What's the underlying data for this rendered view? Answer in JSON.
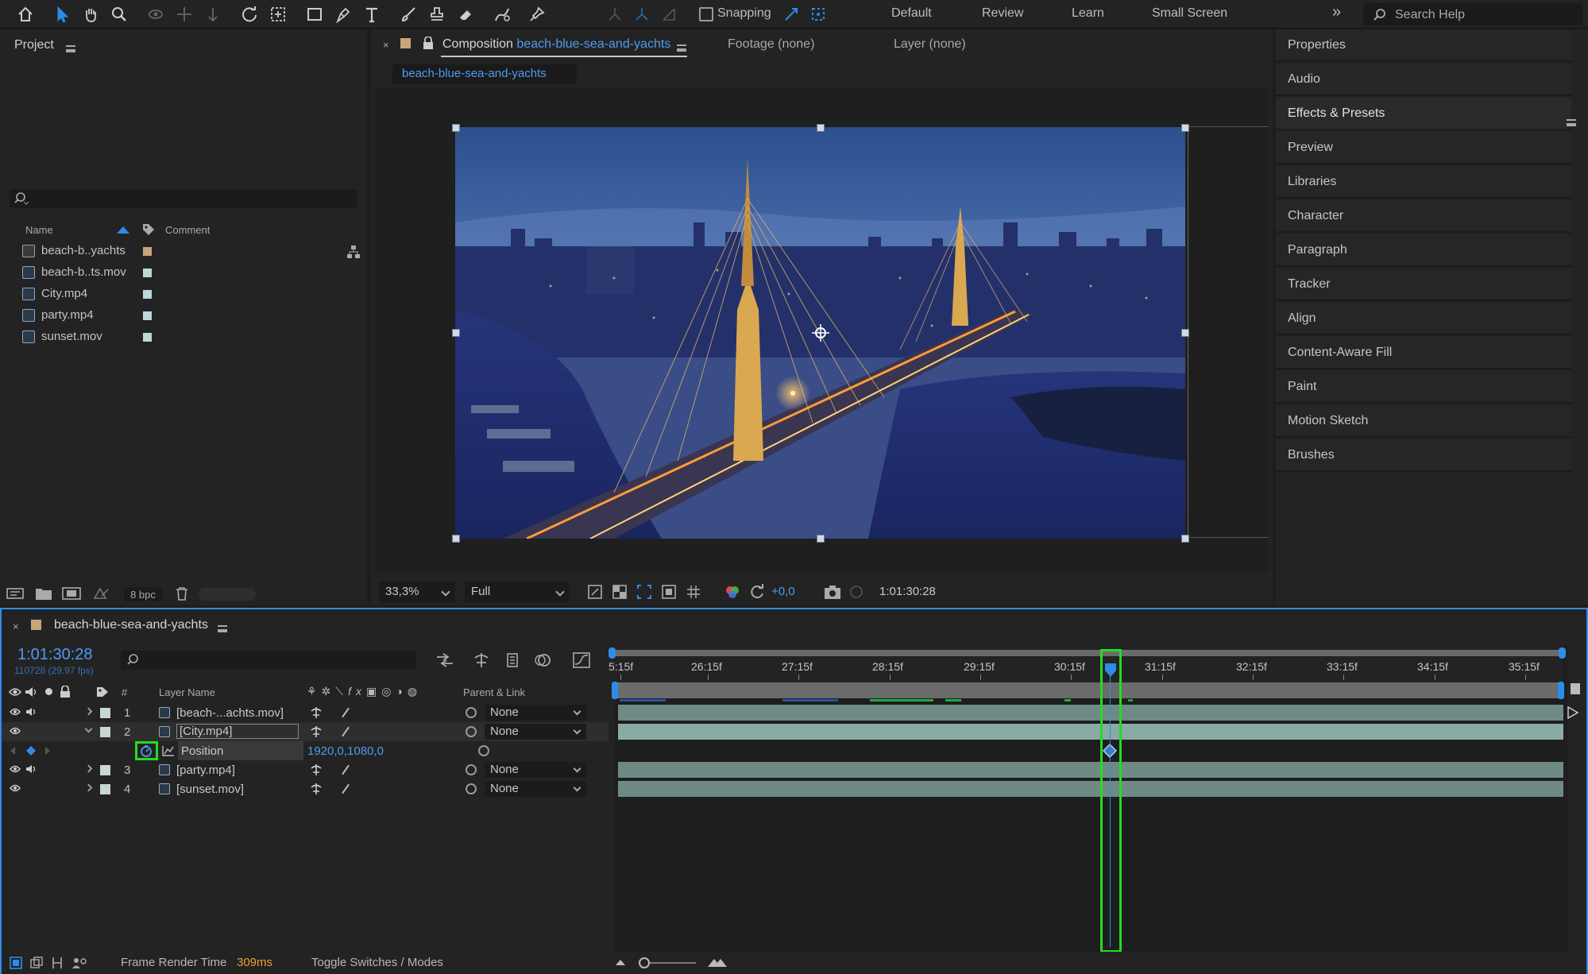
{
  "toolbar": {
    "tools": [
      "home-icon",
      "selection-tool-icon",
      "hand-tool-icon",
      "zoom-tool-icon",
      "orbit-camera-icon",
      "pan-camera-icon",
      "dolly-camera-icon",
      "rotation-tool-icon",
      "pan-behind-icon",
      "rectangle-tool-icon",
      "pen-tool-icon",
      "type-tool-icon",
      "brush-tool-icon",
      "clone-stamp-icon",
      "eraser-icon",
      "roto-brush-icon",
      "puppet-pin-icon"
    ],
    "snapping_label": "Snapping",
    "workspaces": [
      "Default",
      "Review",
      "Learn",
      "Small Screen"
    ],
    "more": "»",
    "search_placeholder": "Search Help"
  },
  "project": {
    "title": "Project",
    "col_name": "Name",
    "col_comment": "Comment",
    "items": [
      {
        "name": "beach-b..yachts",
        "type": "composition",
        "color": "#c9a57a"
      },
      {
        "name": "beach-b..ts.mov",
        "type": "footage",
        "color": "#bcd8d8"
      },
      {
        "name": "City.mp4",
        "type": "footage",
        "color": "#bcd8d8"
      },
      {
        "name": "party.mp4",
        "type": "footage",
        "color": "#bcd8d8"
      },
      {
        "name": "sunset.mov",
        "type": "footage",
        "color": "#bcd8d8"
      }
    ],
    "bpc": "8 bpc"
  },
  "composition": {
    "tab_prefix": "Composition",
    "tab_name": "beach-blue-sea-and-yachts",
    "footage_tab": "Footage (none)",
    "layer_tab": "Layer (none)",
    "breadcrumb": "beach-blue-sea-and-yachts",
    "zoom": "33,3%",
    "resolution": "Full",
    "exposure": "+0,0",
    "timecode": "1:01:30:28"
  },
  "right_panels": [
    "Properties",
    "Audio",
    "Effects & Presets",
    "Preview",
    "Libraries",
    "Character",
    "Paragraph",
    "Tracker",
    "Align",
    "Content-Aware Fill",
    "Paint",
    "Motion Sketch",
    "Brushes"
  ],
  "timeline": {
    "comp_name": "beach-blue-sea-and-yachts",
    "current_time": "1:01:30:28",
    "frame_info": "110728 (29.97 fps)",
    "col_layer_name": "Layer Name",
    "col_parent": "Parent & Link",
    "ruler": [
      "5:15f",
      "26:15f",
      "27:15f",
      "28:15f",
      "29:15f",
      "30:15f",
      "31:15f",
      "32:15f",
      "33:15f",
      "34:15f",
      "35:15f"
    ],
    "layers": [
      {
        "num": "1",
        "name": "[beach-...achts.mov]",
        "parent": "None",
        "expanded": false
      },
      {
        "num": "2",
        "name": "[City.mp4]",
        "parent": "None",
        "expanded": true
      },
      {
        "num": "3",
        "name": "[party.mp4]",
        "parent": "None",
        "expanded": false
      },
      {
        "num": "4",
        "name": "[sunset.mov]",
        "parent": "None",
        "expanded": false
      }
    ],
    "property": {
      "name": "Position",
      "value": "1920,0,1080,0"
    },
    "status_label": "Frame Render Time",
    "status_value": "309ms",
    "toggle_label": "Toggle Switches / Modes"
  },
  "colors": {
    "accent": "#2d8ceb",
    "highlight": "#22dd22",
    "layer_bar": "#6f8a84"
  }
}
